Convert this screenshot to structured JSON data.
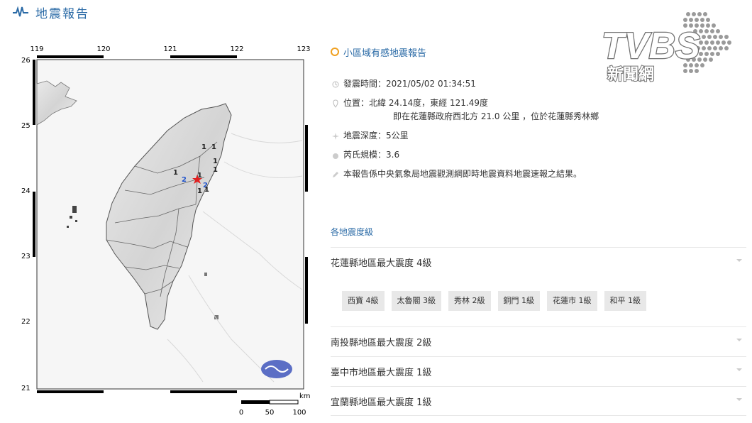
{
  "header": {
    "title": "地震報告",
    "icon": "pulse-icon"
  },
  "report": {
    "type": "小區域有感地震報告",
    "time_label": "發震時間：2021/05/02 01:34:51",
    "location_label": "位置：北緯 24.14度，東經 121.49度",
    "location_detail": "即在花蓮縣政府西北方 21.0 公里 ，位於花蓮縣秀林鄉",
    "depth_label": "地震深度：5公里",
    "magnitude_label": "芮氏規模：3.6",
    "note": "本報告係中央氣象局地震觀測網即時地震資料地震速報之結果。"
  },
  "intensity": {
    "section_title": "各地震度級",
    "counties": [
      "花蓮縣地區最大震度 4級",
      "南投縣地區最大震度 2級",
      "臺中市地區最大震度 1級",
      "宜蘭縣地區最大震度 1級"
    ],
    "towns": [
      "西寶 4級",
      "太魯閣 3級",
      "秀林 2級",
      "銅門 1級",
      "花蓮市 1級",
      "和平 1級"
    ]
  },
  "map": {
    "lon_ticks": [
      "119",
      "120",
      "121",
      "122",
      "123"
    ],
    "lat_ticks": [
      "26",
      "25",
      "24",
      "23",
      "22",
      "21"
    ],
    "scale_unit": "km",
    "scale_labels": [
      "0",
      "50",
      "100"
    ],
    "station_labels": [
      "1",
      "1",
      "1",
      "1",
      "1",
      "2",
      "2",
      "1",
      "1",
      "1"
    ],
    "epicenter_color": "#e02020",
    "intensity_colors": {
      "one": "#222222",
      "two": "#2255cc"
    }
  },
  "logo": {
    "brand": "TVBS",
    "subtitle": "新聞網"
  }
}
